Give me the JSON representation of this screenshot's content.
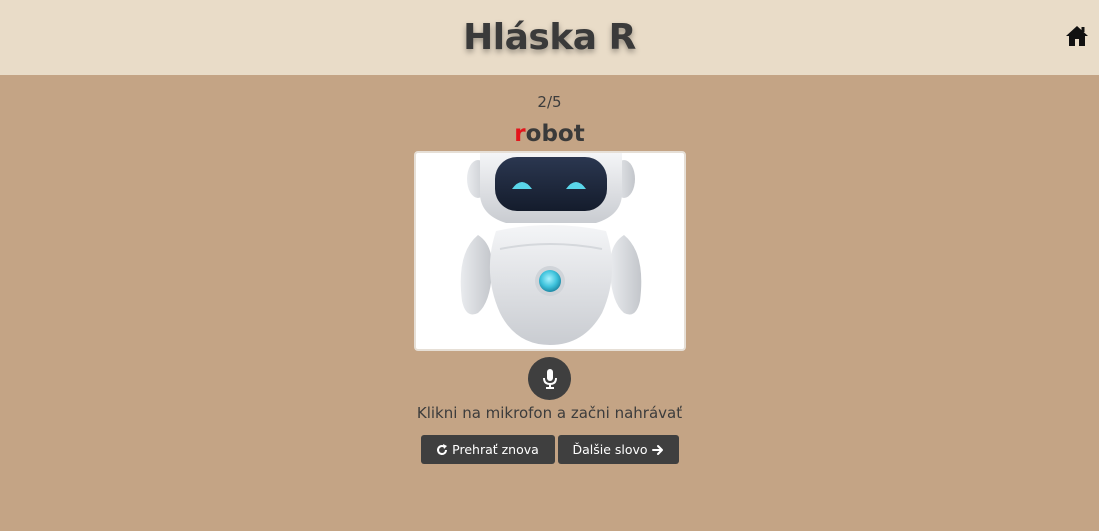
{
  "header": {
    "title": "Hláska R",
    "home_icon": "home-icon"
  },
  "progress": "2/5",
  "word": {
    "highlight": "r",
    "rest": "obot"
  },
  "image": {
    "subject_icon": "robot-illustration"
  },
  "mic": {
    "icon": "microphone-icon"
  },
  "hint": "Klikni na mikrofon a začni nahrávať",
  "buttons": {
    "replay_label": "Prehrať znova",
    "next_label": "Ďalšie slovo"
  },
  "colors": {
    "background": "#c4a485",
    "header": "#e9dcc8",
    "accent_letter": "#e4141b",
    "button": "#3f3f3f"
  }
}
